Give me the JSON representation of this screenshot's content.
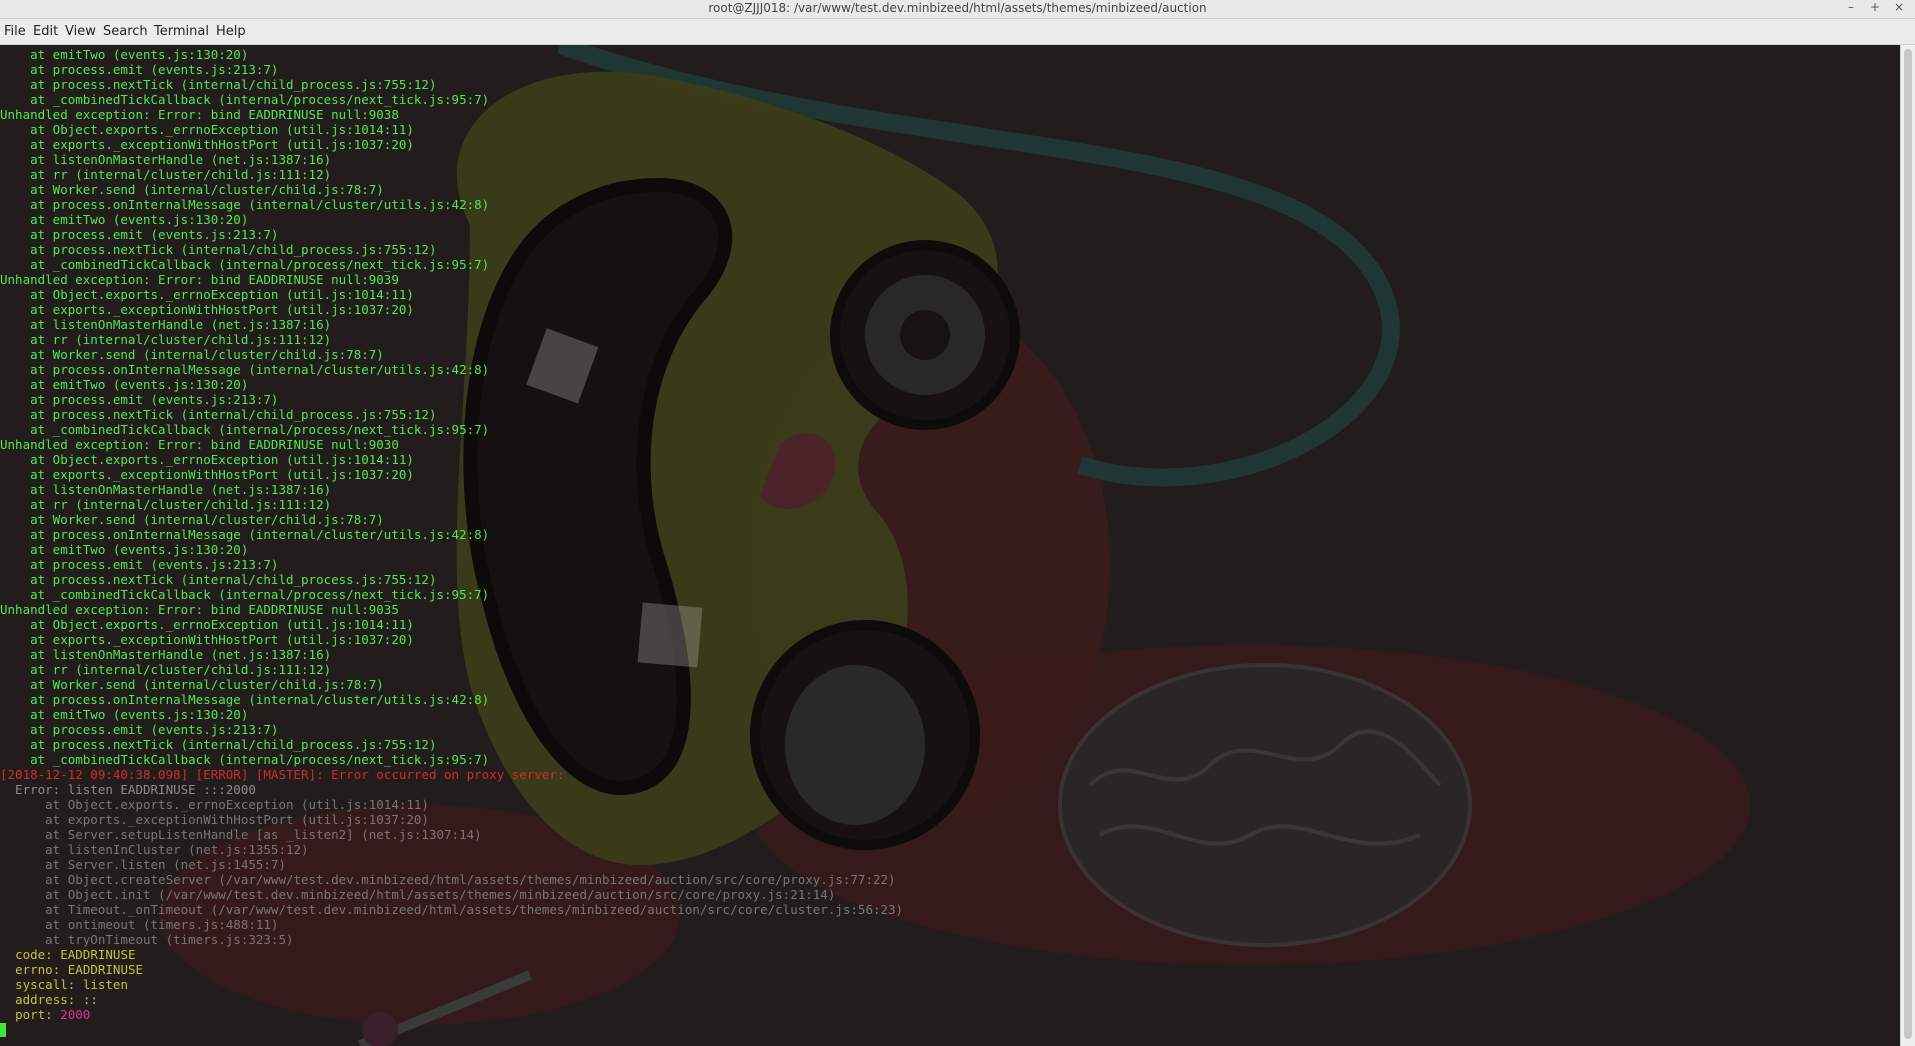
{
  "window": {
    "title": "root@ZJJJ018: /var/www/test.dev.minbizeed/html/assets/themes/minbizeed/auction",
    "controls": {
      "minimize": "–",
      "maximize": "+",
      "close": "×"
    }
  },
  "menu": [
    "File",
    "Edit",
    "View",
    "Search",
    "Terminal",
    "Help"
  ],
  "colors": {
    "green": "#52e84c",
    "red": "#cf2b2b",
    "gray": "#8d8a8a",
    "yellow": "#c7c03c",
    "magenta": "#d43590"
  },
  "terminal": {
    "lines": [
      {
        "text": "    at emitTwo (events.js:130:20)",
        "color": "g"
      },
      {
        "text": "    at process.emit (events.js:213:7)",
        "color": "g"
      },
      {
        "text": "    at process.nextTick (internal/child_process.js:755:12)",
        "color": "g"
      },
      {
        "text": "    at _combinedTickCallback (internal/process/next_tick.js:95:7)",
        "color": "g"
      },
      {
        "text": "Unhandled exception: Error: bind EADDRINUSE null:9038",
        "color": "g"
      },
      {
        "text": "    at Object.exports._errnoException (util.js:1014:11)",
        "color": "g"
      },
      {
        "text": "    at exports._exceptionWithHostPort (util.js:1037:20)",
        "color": "g"
      },
      {
        "text": "    at listenOnMasterHandle (net.js:1387:16)",
        "color": "g"
      },
      {
        "text": "    at rr (internal/cluster/child.js:111:12)",
        "color": "g"
      },
      {
        "text": "    at Worker.send (internal/cluster/child.js:78:7)",
        "color": "g"
      },
      {
        "text": "    at process.onInternalMessage (internal/cluster/utils.js:42:8)",
        "color": "g"
      },
      {
        "text": "    at emitTwo (events.js:130:20)",
        "color": "g"
      },
      {
        "text": "    at process.emit (events.js:213:7)",
        "color": "g"
      },
      {
        "text": "    at process.nextTick (internal/child_process.js:755:12)",
        "color": "g"
      },
      {
        "text": "    at _combinedTickCallback (internal/process/next_tick.js:95:7)",
        "color": "g"
      },
      {
        "text": "Unhandled exception: Error: bind EADDRINUSE null:9039",
        "color": "g"
      },
      {
        "text": "    at Object.exports._errnoException (util.js:1014:11)",
        "color": "g"
      },
      {
        "text": "    at exports._exceptionWithHostPort (util.js:1037:20)",
        "color": "g"
      },
      {
        "text": "    at listenOnMasterHandle (net.js:1387:16)",
        "color": "g"
      },
      {
        "text": "    at rr (internal/cluster/child.js:111:12)",
        "color": "g"
      },
      {
        "text": "    at Worker.send (internal/cluster/child.js:78:7)",
        "color": "g"
      },
      {
        "text": "    at process.onInternalMessage (internal/cluster/utils.js:42:8)",
        "color": "g"
      },
      {
        "text": "    at emitTwo (events.js:130:20)",
        "color": "g"
      },
      {
        "text": "    at process.emit (events.js:213:7)",
        "color": "g"
      },
      {
        "text": "    at process.nextTick (internal/child_process.js:755:12)",
        "color": "g"
      },
      {
        "text": "    at _combinedTickCallback (internal/process/next_tick.js:95:7)",
        "color": "g"
      },
      {
        "text": "Unhandled exception: Error: bind EADDRINUSE null:9030",
        "color": "g"
      },
      {
        "text": "    at Object.exports._errnoException (util.js:1014:11)",
        "color": "g"
      },
      {
        "text": "    at exports._exceptionWithHostPort (util.js:1037:20)",
        "color": "g"
      },
      {
        "text": "    at listenOnMasterHandle (net.js:1387:16)",
        "color": "g"
      },
      {
        "text": "    at rr (internal/cluster/child.js:111:12)",
        "color": "g"
      },
      {
        "text": "    at Worker.send (internal/cluster/child.js:78:7)",
        "color": "g"
      },
      {
        "text": "    at process.onInternalMessage (internal/cluster/utils.js:42:8)",
        "color": "g"
      },
      {
        "text": "    at emitTwo (events.js:130:20)",
        "color": "g"
      },
      {
        "text": "    at process.emit (events.js:213:7)",
        "color": "g"
      },
      {
        "text": "    at process.nextTick (internal/child_process.js:755:12)",
        "color": "g"
      },
      {
        "text": "    at _combinedTickCallback (internal/process/next_tick.js:95:7)",
        "color": "g"
      },
      {
        "text": "Unhandled exception: Error: bind EADDRINUSE null:9035",
        "color": "g"
      },
      {
        "text": "    at Object.exports._errnoException (util.js:1014:11)",
        "color": "g"
      },
      {
        "text": "    at exports._exceptionWithHostPort (util.js:1037:20)",
        "color": "g"
      },
      {
        "text": "    at listenOnMasterHandle (net.js:1387:16)",
        "color": "g"
      },
      {
        "text": "    at rr (internal/cluster/child.js:111:12)",
        "color": "g"
      },
      {
        "text": "    at Worker.send (internal/cluster/child.js:78:7)",
        "color": "g"
      },
      {
        "text": "    at process.onInternalMessage (internal/cluster/utils.js:42:8)",
        "color": "g"
      },
      {
        "text": "    at emitTwo (events.js:130:20)",
        "color": "g"
      },
      {
        "text": "    at process.emit (events.js:213:7)",
        "color": "g"
      },
      {
        "text": "    at process.nextTick (internal/child_process.js:755:12)",
        "color": "g"
      },
      {
        "text": "    at _combinedTickCallback (internal/process/next_tick.js:95:7)",
        "color": "g"
      },
      {
        "text": "[2018-12-12 09:40:38.098] [ERROR] [MASTER]: Error occurred on proxy server:",
        "color": "r"
      },
      {
        "text": "  Error: listen EADDRINUSE :::2000",
        "color": "d"
      },
      {
        "text": "      at Object.exports._errnoException (util.js:1014:11)",
        "color": "dim"
      },
      {
        "text": "      at exports._exceptionWithHostPort (util.js:1037:20)",
        "color": "dim"
      },
      {
        "text": "      at Server.setupListenHandle [as _listen2] (net.js:1307:14)",
        "color": "dim"
      },
      {
        "text": "      at listenInCluster (net.js:1355:12)",
        "color": "dim"
      },
      {
        "text": "      at Server.listen (net.js:1455:7)",
        "color": "dim"
      },
      {
        "text": "      at Object.createServer (/var/www/test.dev.minbizeed/html/assets/themes/minbizeed/auction/src/core/proxy.js:77:22)",
        "color": "dim"
      },
      {
        "text": "      at Object.init (/var/www/test.dev.minbizeed/html/assets/themes/minbizeed/auction/src/core/proxy.js:21:14)",
        "color": "dim"
      },
      {
        "text": "      at Timeout._onTimeout (/var/www/test.dev.minbizeed/html/assets/themes/minbizeed/auction/src/core/cluster.js:56:23)",
        "color": "dim"
      },
      {
        "text": "      at ontimeout (timers.js:488:11)",
        "color": "dim"
      },
      {
        "text": "      at tryOnTimeout (timers.js:323:5)",
        "color": "dim"
      }
    ],
    "props": [
      {
        "key": "code",
        "value": "EADDRINUSE",
        "vcolor": "val-y"
      },
      {
        "key": "errno",
        "value": "EADDRINUSE",
        "vcolor": "val-y"
      },
      {
        "key": "syscall",
        "value": "listen",
        "vcolor": "val-y"
      },
      {
        "key": "address",
        "value": "::",
        "vcolor": "val-y"
      },
      {
        "key": "port",
        "value": "2000",
        "vcolor": "val-m"
      }
    ]
  }
}
